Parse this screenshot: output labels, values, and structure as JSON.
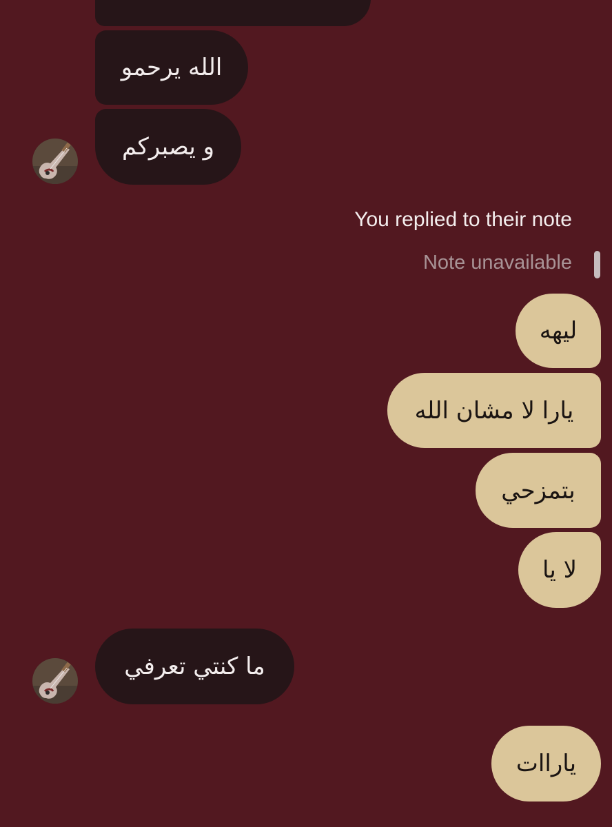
{
  "conversation": {
    "incoming": [
      {
        "text": "الله يرحمو"
      },
      {
        "text": "و يصبركم"
      },
      {
        "text": "ما كنتي تعرفي"
      }
    ],
    "note_reply": {
      "label": "You replied to their note",
      "status": "Note unavailable"
    },
    "outgoing": [
      {
        "text": "ليهه"
      },
      {
        "text": "يارا لا مشان الله"
      },
      {
        "text": "بتمزحي"
      },
      {
        "text": "لا يا"
      },
      {
        "text": "ياراات"
      }
    ]
  },
  "colors": {
    "background": "#521820",
    "incoming_bubble": "#261518",
    "outgoing_bubble": "#dbc69a"
  },
  "icons": {
    "avatar": "guitar-photo-avatar"
  }
}
